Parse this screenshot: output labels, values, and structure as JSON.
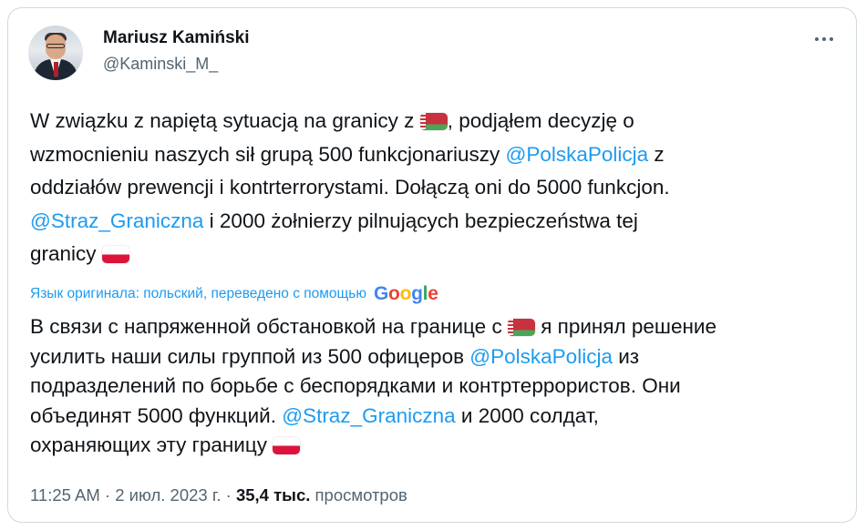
{
  "author": {
    "name": "Mariusz Kamiński",
    "handle": "@Kaminski_M_"
  },
  "tweet": {
    "line1_pre": "W związku z napiętą sytuacją na granicy z ",
    "line1_post": ", podjąłem decyzję o",
    "line2_pre": "wzmocnieniu naszych sił grupą 500 funkcjonariuszy ",
    "mention1": "@PolskaPolicja",
    "line2_post": " z",
    "line3": "oddziałów prewencji i kontrterrorystami. Dołączą oni do 5000 funkcjon.",
    "mention2": "@Straz_Graniczna",
    "line4_post": " i 2000 żołnierzy pilnujących bezpieczeństwa tej",
    "line5": "granicy "
  },
  "translation_note": {
    "label": "Язык оригинала: польский, переведено с помощью",
    "provider": "Google"
  },
  "translated": {
    "line1_pre": "В связи с напряженной обстановкой на границе с ",
    "line1_post": " я принял решение",
    "line2_pre": "усилить наши силы группой из 500 офицеров ",
    "mention1": "@PolskaPolicja",
    "line2_post": " из",
    "line3": "подразделений по борьбе с беспорядками и контртеррористов. Они",
    "line4_pre": "объединят 5000 функций. ",
    "mention2": "@Straz_Graniczna",
    "line4_post": " и 2000 солдат,",
    "line5": "охраняющих эту границу "
  },
  "meta": {
    "time": "11:25 AM",
    "sep1": " · ",
    "date": "2 июл. 2023 г.",
    "sep2": " · ",
    "views_count": "35,4 тыс.",
    "views_label": " просмотров"
  },
  "colors": {
    "link": "#1d9bf0",
    "text": "#0f1419",
    "secondary": "#536471"
  },
  "icons": {
    "more": "more-horizontal-icon",
    "flag_pl": "flag-poland-icon",
    "flag_by": "flag-belarus-icon"
  }
}
